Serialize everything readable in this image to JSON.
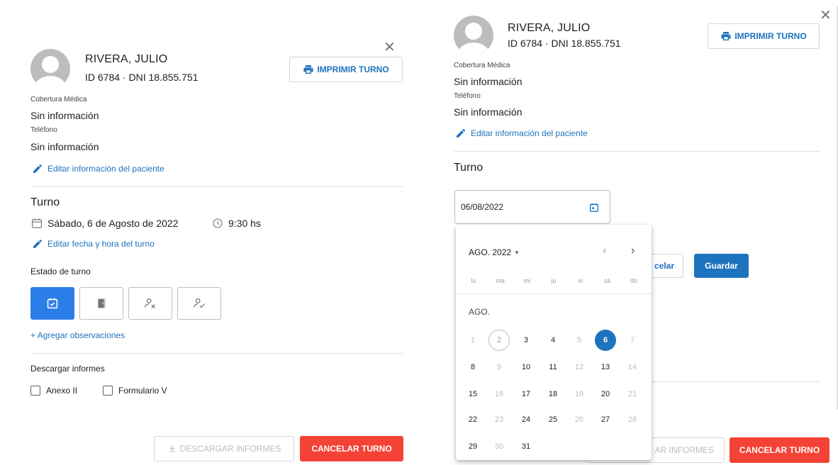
{
  "patient": {
    "name": "RIVERA, JULIO",
    "id_line": "ID 6784 · DNI 18.855.751",
    "coverage_label": "Cobertura Médica",
    "coverage_value": "Sin información",
    "phone_label": "Teléfono",
    "phone_value": "Sin información",
    "edit_link": "Editar información del paciente"
  },
  "print_button": "IMPRIMIR TURNO",
  "turno": {
    "title": "Turno",
    "date_text": "Sábado, 6 de Agosto de 2022",
    "time_text": "9:30 hs",
    "edit_link": "Editar fecha y hora del turno",
    "status_label": "Estado de turno",
    "add_obs": "+ Agregar observaciones"
  },
  "reports": {
    "title": "Descargar informes",
    "options": [
      "Anexo II",
      "Formulario V"
    ]
  },
  "footer": {
    "download_label": "DESCARGAR INFORMES",
    "download_partial": "AR INFORMES",
    "cancel_label": "CANCELAR TURNO"
  },
  "edit_form": {
    "date_value": "06/08/2022",
    "cancel_partial": "celar",
    "save_label": "Guardar"
  },
  "calendar": {
    "month_year": "AGO. 2022",
    "month_label": "AGO.",
    "weekdays": [
      "lu",
      "ma",
      "mi",
      "ju",
      "vi",
      "sá",
      "do"
    ],
    "weeks": [
      [
        "1",
        "2",
        "3",
        "4",
        "5",
        "6",
        "7"
      ],
      [
        "8",
        "9",
        "10",
        "11",
        "12",
        "13",
        "14"
      ],
      [
        "15",
        "16",
        "17",
        "18",
        "19",
        "20",
        "21"
      ],
      [
        "22",
        "23",
        "24",
        "25",
        "26",
        "27",
        "28"
      ],
      [
        "29",
        "30",
        "31",
        "",
        "",
        "",
        ""
      ]
    ],
    "selected": "6",
    "today": "2",
    "dim_days": [
      "1",
      "5",
      "7",
      "9",
      "12",
      "14",
      "16",
      "19",
      "21",
      "23",
      "26",
      "28",
      "30"
    ]
  },
  "colors": {
    "primary": "#1e73be",
    "active_state": "#2b7de9",
    "danger": "#f44336"
  }
}
